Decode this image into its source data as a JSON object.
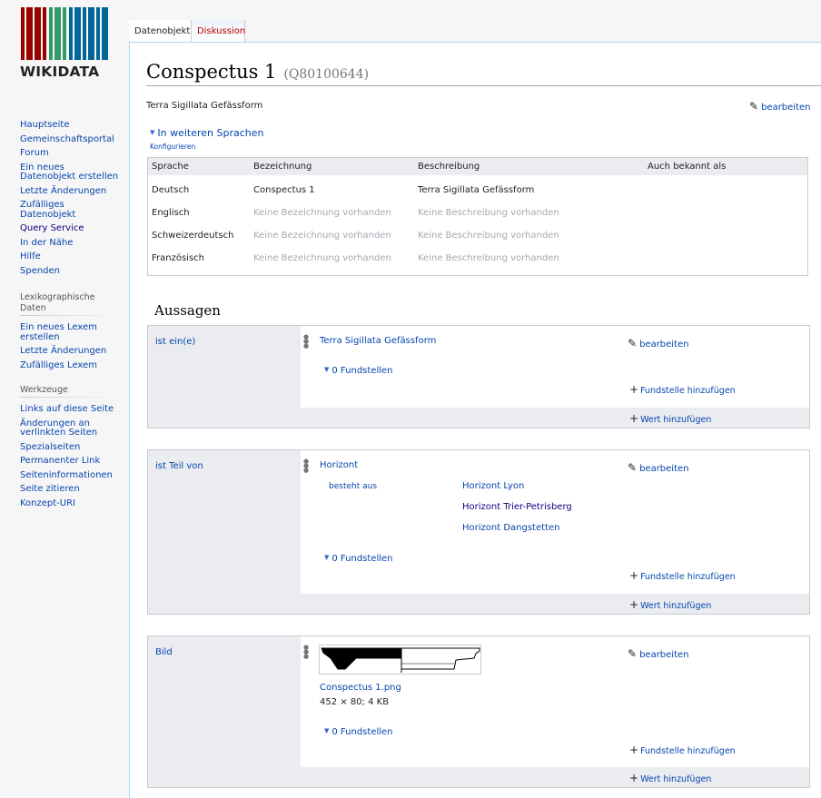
{
  "logo": {
    "wordmark": "WIKIDATA",
    "bar_colors": [
      "#990000",
      "#339966",
      "#006699"
    ]
  },
  "sidebar": {
    "main": [
      {
        "label": "Hauptseite"
      },
      {
        "label": "Gemeinschaftsportal"
      },
      {
        "label": "Forum"
      },
      {
        "label": "Ein neues Datenobjekt erstellen"
      },
      {
        "label": "Letzte Änderungen"
      },
      {
        "label": "Zufälliges Datenobjekt"
      },
      {
        "label": "Query Service"
      },
      {
        "label": "In der Nähe"
      },
      {
        "label": "Hilfe"
      },
      {
        "label": "Spenden"
      }
    ],
    "lexeme_heading": "Lexikographische Daten",
    "lexeme": [
      {
        "label": "Ein neues Lexem erstellen"
      },
      {
        "label": "Letzte Änderungen"
      },
      {
        "label": "Zufälliges Lexem"
      }
    ],
    "tools_heading": "Werkzeuge",
    "tools": [
      {
        "label": "Links auf diese Seite"
      },
      {
        "label": "Änderungen an verlinkten Seiten"
      },
      {
        "label": "Spezialseiten"
      },
      {
        "label": "Permanenter Link"
      },
      {
        "label": "Seiteninformationen"
      },
      {
        "label": "Seite zitieren"
      },
      {
        "label": "Konzept-URI"
      }
    ]
  },
  "tabs": {
    "item": "Datenobjekt",
    "discussion": "Diskussion"
  },
  "page": {
    "title": "Conspectus 1",
    "qid": "(Q80100644)",
    "description": "Terra Sigillata Gefässform",
    "edit_label": "bearbeiten"
  },
  "languages": {
    "toggle": "In weiteren Sprachen",
    "configure": "Konfigurieren",
    "headers": [
      "Sprache",
      "Bezeichnung",
      "Beschreibung",
      "Auch bekannt als"
    ],
    "rows": [
      {
        "lang": "Deutsch",
        "label": "Conspectus 1",
        "desc": "Terra Sigillata Gefässform",
        "label_missing": false,
        "desc_missing": false
      },
      {
        "lang": "Englisch",
        "label": "Keine Bezeichnung vorhanden",
        "desc": "Keine Beschreibung vorhanden",
        "label_missing": true,
        "desc_missing": true
      },
      {
        "lang": "Schweizerdeutsch",
        "label": "Keine Bezeichnung vorhanden",
        "desc": "Keine Beschreibung vorhanden",
        "label_missing": true,
        "desc_missing": true
      },
      {
        "lang": "Französisch",
        "label": "Keine Bezeichnung vorhanden",
        "desc": "Keine Beschreibung vorhanden",
        "label_missing": true,
        "desc_missing": true
      }
    ]
  },
  "statements": {
    "heading": "Aussagen",
    "edit_label": "bearbeiten",
    "refs_label": "0 Fundstellen",
    "add_ref_label": "Fundstelle hinzufügen",
    "add_value_label": "Wert hinzufügen",
    "instance_of": {
      "property": "ist ein(e)",
      "value": "Terra Sigillata Gefässform"
    },
    "part_of": {
      "property": "ist Teil von",
      "value": "Horizont",
      "qualifier_property": "besteht aus",
      "qualifier_values": [
        "Horizont Lyon",
        "Horizont Trier-Petrisberg",
        "Horizont Dangstetten"
      ]
    },
    "image": {
      "property": "Bild",
      "file": "Conspectus 1.png",
      "meta": "452 × 80; 4 KB"
    }
  }
}
